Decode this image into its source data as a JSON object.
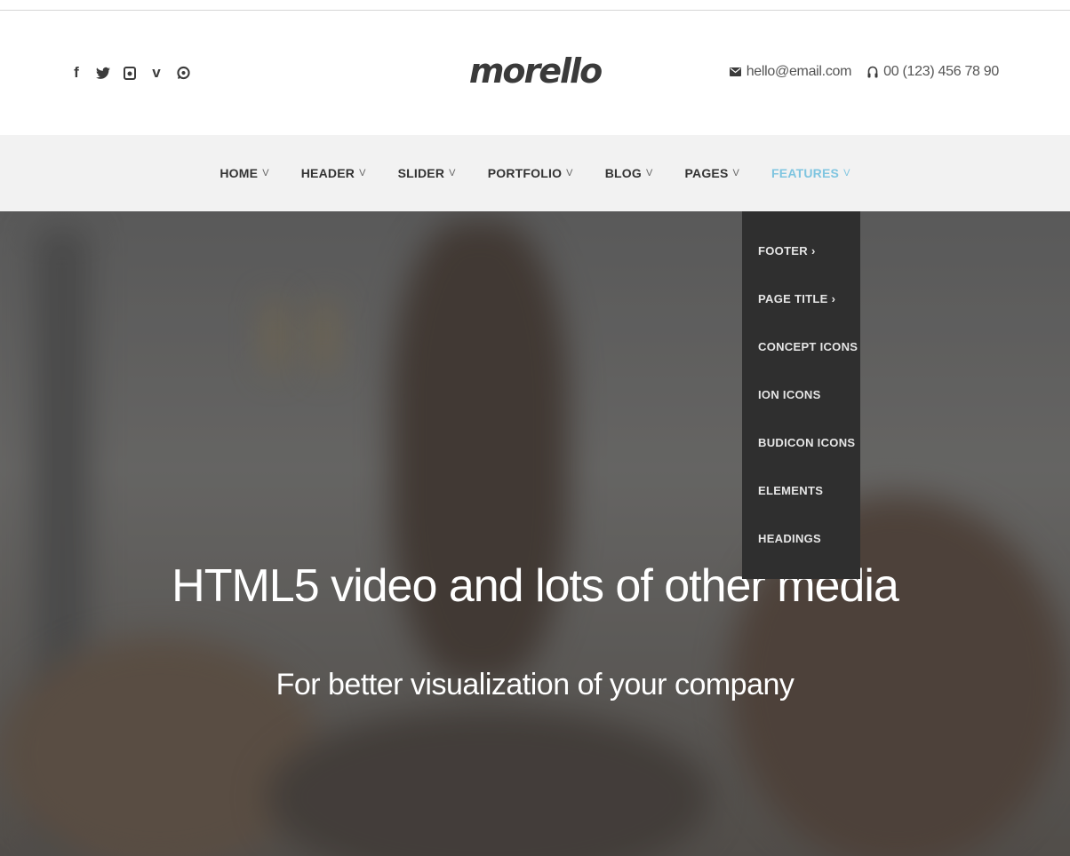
{
  "header": {
    "logo": "morello",
    "social": [
      {
        "name": "facebook-icon",
        "glyph": "f"
      },
      {
        "name": "twitter-icon",
        "glyph": "🐦"
      },
      {
        "name": "instagram-icon",
        "glyph": "◙"
      },
      {
        "name": "vimeo-icon",
        "glyph": "v"
      },
      {
        "name": "whatsapp-icon",
        "glyph": "◐"
      }
    ],
    "email": "hello@email.com",
    "phone": "00 (123) 456 78 90"
  },
  "nav": {
    "items": [
      {
        "label": "HOME",
        "chevron": "v"
      },
      {
        "label": "HEADER",
        "chevron": "v"
      },
      {
        "label": "SLIDER",
        "chevron": "v"
      },
      {
        "label": "PORTFOLIO",
        "chevron": "v"
      },
      {
        "label": "BLOG",
        "chevron": "v"
      },
      {
        "label": "PAGES",
        "chevron": "v"
      },
      {
        "label": "FEATURES",
        "chevron": "v"
      }
    ],
    "active_color": "#7fc5e0"
  },
  "dropdown": {
    "items": [
      {
        "label": "FOOTER",
        "arrow": "›"
      },
      {
        "label": "PAGE TITLE",
        "arrow": "›"
      },
      {
        "label": "CONCEPT ICONS",
        "arrow": ""
      },
      {
        "label": "ION ICONS",
        "arrow": ""
      },
      {
        "label": "BUDICON ICONS",
        "arrow": ""
      },
      {
        "label": "ELEMENTS",
        "arrow": ""
      },
      {
        "label": "HEADINGS",
        "arrow": ""
      }
    ]
  },
  "hero": {
    "title": "HTML5 video and lots of other media",
    "subtitle": "For better visualization of your company"
  }
}
